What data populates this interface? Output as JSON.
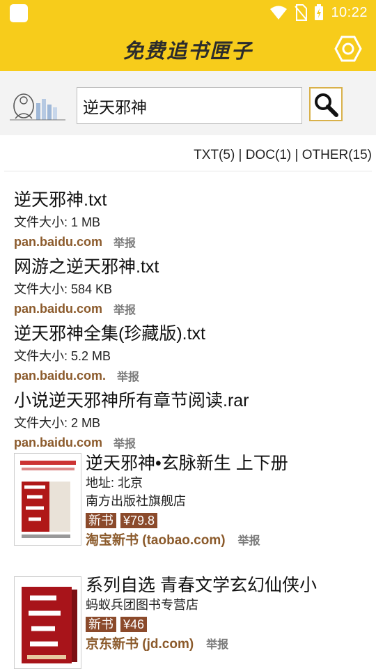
{
  "status_bar": {
    "time": "10:22",
    "icons": [
      "app-icon",
      "wifi-icon",
      "no-sim-icon",
      "battery-charging-icon"
    ]
  },
  "app_bar": {
    "title": "免费追书匣子",
    "settings_icon": "hexagon-settings-icon"
  },
  "search": {
    "logo_icon": "sketch-logo-icon",
    "query": "逆天邪神",
    "button_icon": "search-icon"
  },
  "filters": {
    "text": "TXT(5) | DOC(1) | OTHER(15)"
  },
  "results": [
    {
      "title": "逆天邪神.txt",
      "size": "文件大小: 1 MB",
      "source": "pan.baidu.com",
      "report": "举报"
    },
    {
      "title": "网游之逆天邪神.txt",
      "size": "文件大小: 584 KB",
      "source": "pan.baidu.com",
      "report": "举报"
    },
    {
      "title": "逆天邪神全集(珍藏版).txt",
      "size": "文件大小: 5.2 MB",
      "source": "pan.baidu.com.",
      "report": "举报"
    },
    {
      "title": "小说逆天邪神所有章节阅读.rar",
      "size": "文件大小: 2 MB",
      "source": "pan.baidu.com",
      "report": "举报"
    }
  ],
  "books": [
    {
      "title": "逆天邪神•玄脉新生 上下册",
      "address": "地址: 北京",
      "shop": "南方出版社旗舰店",
      "tag_new": "新书",
      "price": "¥79.8",
      "source": "淘宝新书 (taobao.com)",
      "report": "举报",
      "cover_icon": "book-cover-image"
    },
    {
      "title": "系列自选 青春文学玄幻仙侠小",
      "shop": "蚂蚁兵团图书专营店",
      "tag_new": "新书",
      "price": "¥46",
      "source": "京东新书 (jd.com)",
      "report": "举报",
      "cover_icon": "book-cover-image"
    }
  ],
  "colors": {
    "accent": "#f7cc1b",
    "link": "#8b5a2b",
    "tag": "#8b4a2b"
  }
}
